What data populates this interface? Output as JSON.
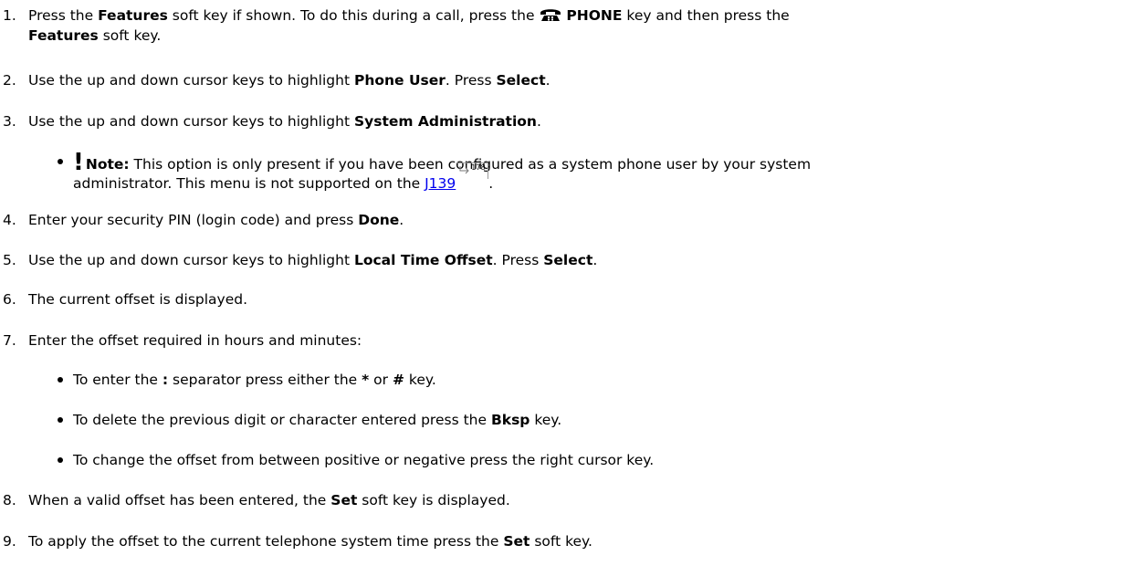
{
  "steps": [
    {
      "num": "1.",
      "line1": [
        "Press the ",
        "Features",
        " soft key if shown. To do this during a call, press the ",
        "PHONE",
        " key and then press the"
      ],
      "line2": [
        "Features",
        " soft key."
      ]
    },
    {
      "num": "2.",
      "parts": [
        "Use the up and down cursor keys to highlight ",
        "Phone User",
        ". Press ",
        "Select",
        "."
      ]
    },
    {
      "num": "3.",
      "parts": [
        "Use the up and down cursor keys to highlight ",
        "System Administration",
        "."
      ]
    },
    {
      "num": "4.",
      "parts": [
        "Enter your security PIN (login code) and press ",
        "Done",
        "."
      ]
    },
    {
      "num": "5.",
      "parts": [
        "Use the up and down cursor keys to highlight ",
        "Local Time Offset",
        ". Press ",
        "Select",
        "."
      ]
    },
    {
      "num": "6.",
      "parts": [
        "The current offset is displayed."
      ]
    },
    {
      "num": "7.",
      "parts": [
        "Enter the offset required in hours and minutes:"
      ]
    },
    {
      "num": "8.",
      "parts": [
        "When a valid offset has been entered, the ",
        "Set",
        " soft key is displayed."
      ]
    },
    {
      "num": "9.",
      "parts": [
        "To apply the offset to the current telephone system time press the ",
        "Set",
        " soft key."
      ]
    }
  ],
  "note": {
    "icon": "!",
    "label": "Note:",
    "line1": " This option is only present if you have been configured as a system phone user by your system",
    "line2": "administrator. This menu is not supported on the ",
    "link": "J139",
    "page": "178",
    "end": "."
  },
  "sub_bullets": [
    [
      "To enter the ",
      ":",
      " separator press either the ",
      "*",
      " or ",
      "#",
      " key."
    ],
    [
      "To delete the previous digit or character entered press the ",
      "Bksp",
      " key."
    ],
    [
      "To change the offset from between positive or negative press the right cursor key."
    ]
  ],
  "icons": {
    "phone_key": "telephone-icon",
    "xref": "cross-reference-arrow-icon"
  }
}
